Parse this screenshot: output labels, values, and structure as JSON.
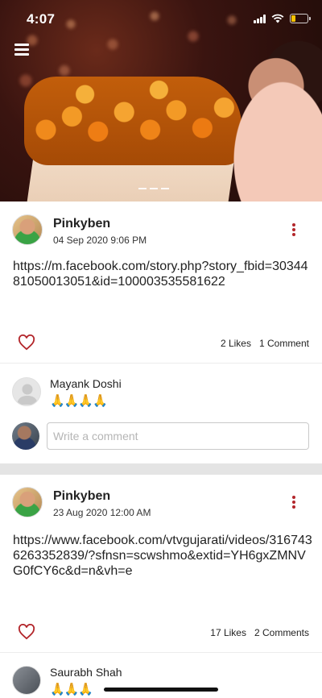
{
  "status_bar": {
    "time": "4:07"
  },
  "hero": {
    "icon": "menu-icon"
  },
  "posts": [
    {
      "author": "Pinkyben",
      "date": "04 Sep 2020 9:06 PM",
      "text": "https://m.facebook.com/story.php?story_fbid=3034481050013051&id=100003535581622",
      "likes": "2 Likes",
      "comments_count": "1 Comment",
      "comment": {
        "author": "Mayank Doshi",
        "text": "🙏🙏🙏🙏"
      },
      "comment_placeholder": "Write a comment"
    },
    {
      "author": "Pinkyben",
      "date": "23 Aug 2020 12:00 AM",
      "text": "https://www.facebook.com/vtvgujarati/videos/3167436263352839/?sfnsn=scwshmo&extid=YH6gxZMNVG0fCY6c&d=n&vh=e",
      "likes": "17 Likes",
      "comments_count": "2 Comments",
      "comment": {
        "author": "Saurabh Shah",
        "text": "🙏🙏🙏"
      }
    }
  ],
  "colors": {
    "accent": "#b3262b",
    "battery": "#f6c300"
  }
}
